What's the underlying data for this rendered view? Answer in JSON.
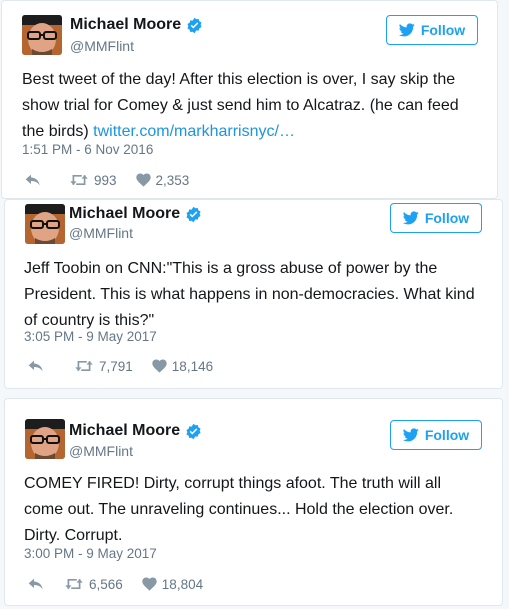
{
  "tweets": [
    {
      "name": "Michael Moore",
      "handle": "@MMFlint",
      "follow_label": "Follow",
      "text": "Best tweet of the day! After this election is over, I say skip the show trial for Comey & just send him to Alcatraz. (he can feed the birds) ",
      "link": "twitter.com/markharrisnyc/…",
      "timestamp": "1:51 PM - 6 Nov 2016",
      "retweets": "993",
      "likes": "2,353"
    },
    {
      "name": "Michael Moore",
      "handle": "@MMFlint",
      "follow_label": "Follow",
      "text": "Jeff Toobin on CNN:\"This is a gross abuse of power by the President. This is what happens in non-democracies. What kind of country is this?\"",
      "link": "",
      "timestamp": "3:05 PM - 9 May 2017",
      "retweets": "7,791",
      "likes": "18,146"
    },
    {
      "name": "Michael Moore",
      "handle": "@MMFlint",
      "follow_label": "Follow",
      "text": "COMEY FIRED! Dirty, corrupt things afoot. The truth will all come out. The unraveling continues... Hold the election over. Dirty. Corrupt.",
      "link": "",
      "timestamp": "3:00 PM - 9 May 2017",
      "retweets": "6,566",
      "likes": "18,804"
    }
  ],
  "colors": {
    "accent": "#1da1f2",
    "link": "#1b95e0",
    "muted": "#657786",
    "verified": "#1da1f2"
  },
  "icons": {
    "verified": "verified-badge-icon",
    "follow": "twitter-bird-icon",
    "reply": "reply-icon",
    "retweet": "retweet-icon",
    "like": "heart-icon"
  }
}
